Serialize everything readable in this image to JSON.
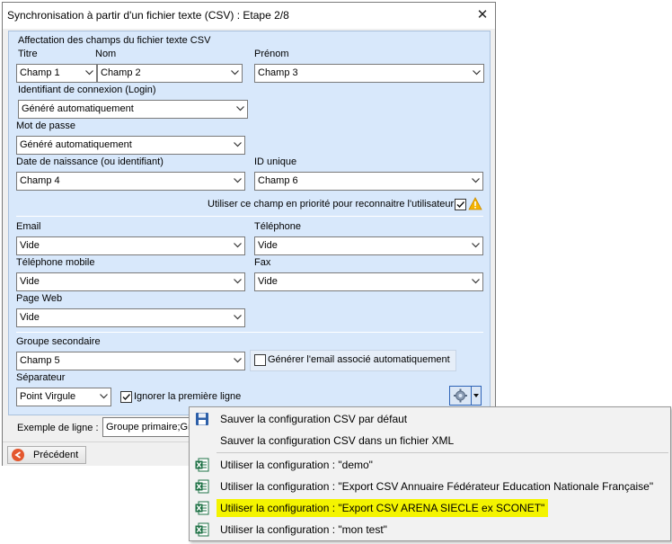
{
  "window": {
    "title": "Synchronisation à partir d'un fichier texte (CSV) : Etape 2/8",
    "close": "✕"
  },
  "group": {
    "title": "Affectation des champs du fichier texte CSV"
  },
  "fields": {
    "titre": {
      "label": "Titre",
      "value": "Champ 1"
    },
    "nom": {
      "label": "Nom",
      "value": "Champ 2"
    },
    "prenom": {
      "label": "Prénom",
      "value": "Champ 3"
    },
    "login": {
      "label": "Identifiant de connexion (Login)",
      "value": "Généré automatiquement"
    },
    "password": {
      "label": "Mot de passe",
      "value": "Généré automatiquement"
    },
    "birthdate": {
      "label": "Date de naissance (ou identifiant)",
      "value": "Champ 4"
    },
    "unique_id": {
      "label": "ID unique",
      "value": "Champ 6"
    },
    "priority": {
      "label": "Utiliser ce champ en priorité pour reconnaitre l'utilisateur",
      "checked": true
    },
    "email": {
      "label": "Email",
      "value": "Vide"
    },
    "phone": {
      "label": "Téléphone",
      "value": "Vide"
    },
    "mobile": {
      "label": "Téléphone mobile",
      "value": "Vide"
    },
    "fax": {
      "label": "Fax",
      "value": "Vide"
    },
    "web": {
      "label": "Page Web",
      "value": "Vide"
    },
    "secondary_group": {
      "label": "Groupe secondaire",
      "value": "Champ 5"
    },
    "gen_email": {
      "label": "Générer l'email associé automatiquement",
      "checked": false
    },
    "separator": {
      "label": "Séparateur",
      "value": "Point Virgule"
    },
    "ignore_first": {
      "label": "Ignorer la première ligne",
      "checked": true
    }
  },
  "example": {
    "label": "Exemple de ligne :",
    "value": "Groupe primaire;Grou"
  },
  "buttons": {
    "previous": "Précédent"
  },
  "menu": {
    "items": [
      {
        "label": "Sauver la configuration CSV par défaut",
        "icon": "save-icon"
      },
      {
        "label": "Sauver la configuration CSV dans un fichier XML",
        "icon": "none"
      },
      {
        "label": "Utiliser la configuration : \"demo\"",
        "icon": "excel-icon"
      },
      {
        "label": "Utiliser la configuration : \"Export CSV Annuaire Fédérateur Education Nationale Française\"",
        "icon": "excel-icon"
      },
      {
        "label": "Utiliser la configuration : \"Export CSV ARENA SIECLE ex SCONET\"",
        "icon": "excel-icon",
        "highlighted": true
      },
      {
        "label": "Utiliser la configuration : \"mon test\"",
        "icon": "excel-icon"
      }
    ]
  },
  "colors": {
    "panel": "#d8e8fb",
    "highlight": "#f4f400",
    "warning": "#f5b400",
    "excel_green": "#1e7145"
  }
}
